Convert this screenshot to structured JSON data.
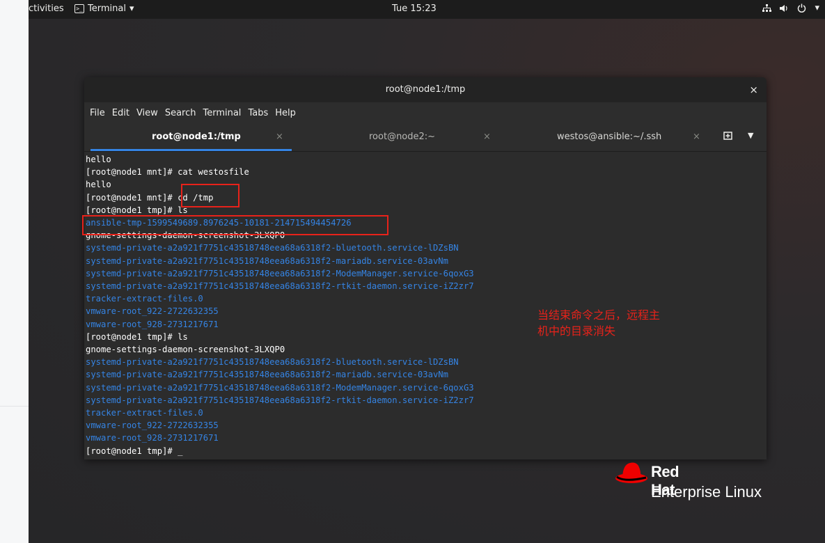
{
  "topbar": {
    "activities": "ctivities",
    "app_menu": "Terminal",
    "clock": "Tue 15:23",
    "icons": [
      "network-icon",
      "volume-icon",
      "power-icon",
      "chevron-down-icon"
    ]
  },
  "window": {
    "title": "root@node1:/tmp",
    "close": "×",
    "menu": [
      "File",
      "Edit",
      "View",
      "Search",
      "Terminal",
      "Tabs",
      "Help"
    ],
    "tabs": [
      {
        "label": "root@node1:/tmp",
        "active": true
      },
      {
        "label": "root@node2:~",
        "active": false
      },
      {
        "label": "westos@ansible:~/.ssh",
        "active": false
      }
    ],
    "tab_close": "×"
  },
  "terminal": {
    "lines": [
      {
        "text": "hello",
        "color": "#ffffff"
      },
      {
        "text": "[root@node1 mnt]# cat westosfile",
        "color": "#ffffff"
      },
      {
        "text": "hello",
        "color": "#ffffff"
      },
      {
        "text": "[root@node1 mnt]# cd /tmp",
        "color": "#ffffff"
      },
      {
        "text": "[root@node1 tmp]# ls",
        "color": "#ffffff"
      },
      {
        "text": "ansible-tmp-1599549689.8976245-10181-214715494454726",
        "color": "#3584e4"
      },
      {
        "text": "gnome-settings-daemon-screenshot-3LXQP0",
        "color": "#ffffff"
      },
      {
        "text": "systemd-private-a2a921f7751c43518748eea68a6318f2-bluetooth.service-lDZsBN",
        "color": "#3584e4"
      },
      {
        "text": "systemd-private-a2a921f7751c43518748eea68a6318f2-mariadb.service-03avNm",
        "color": "#3584e4"
      },
      {
        "text": "systemd-private-a2a921f7751c43518748eea68a6318f2-ModemManager.service-6qoxG3",
        "color": "#3584e4"
      },
      {
        "text": "systemd-private-a2a921f7751c43518748eea68a6318f2-rtkit-daemon.service-iZ2zr7",
        "color": "#3584e4"
      },
      {
        "text": "tracker-extract-files.0",
        "color": "#3584e4"
      },
      {
        "text": "vmware-root_922-2722632355",
        "color": "#3584e4"
      },
      {
        "text": "vmware-root_928-2731217671",
        "color": "#3584e4"
      },
      {
        "text": "[root@node1 tmp]# ls",
        "color": "#ffffff"
      },
      {
        "text": "gnome-settings-daemon-screenshot-3LXQP0",
        "color": "#ffffff"
      },
      {
        "text": "systemd-private-a2a921f7751c43518748eea68a6318f2-bluetooth.service-lDZsBN",
        "color": "#3584e4"
      },
      {
        "text": "systemd-private-a2a921f7751c43518748eea68a6318f2-mariadb.service-03avNm",
        "color": "#3584e4"
      },
      {
        "text": "systemd-private-a2a921f7751c43518748eea68a6318f2-ModemManager.service-6qoxG3",
        "color": "#3584e4"
      },
      {
        "text": "systemd-private-a2a921f7751c43518748eea68a6318f2-rtkit-daemon.service-iZ2zr7",
        "color": "#3584e4"
      },
      {
        "text": "tracker-extract-files.0",
        "color": "#3584e4"
      },
      {
        "text": "vmware-root_922-2722632355",
        "color": "#3584e4"
      },
      {
        "text": "vmware-root_928-2731217671",
        "color": "#3584e4"
      },
      {
        "text": "[root@node1 tmp]# _",
        "color": "#ffffff"
      }
    ]
  },
  "annotation": {
    "text": "当结束命令之后，远程主机中的目录消失",
    "color": "#e8221a"
  },
  "logo": {
    "brand": "Red Hat",
    "product": "Enterprise Linux",
    "hat_color": "#ee0000"
  }
}
